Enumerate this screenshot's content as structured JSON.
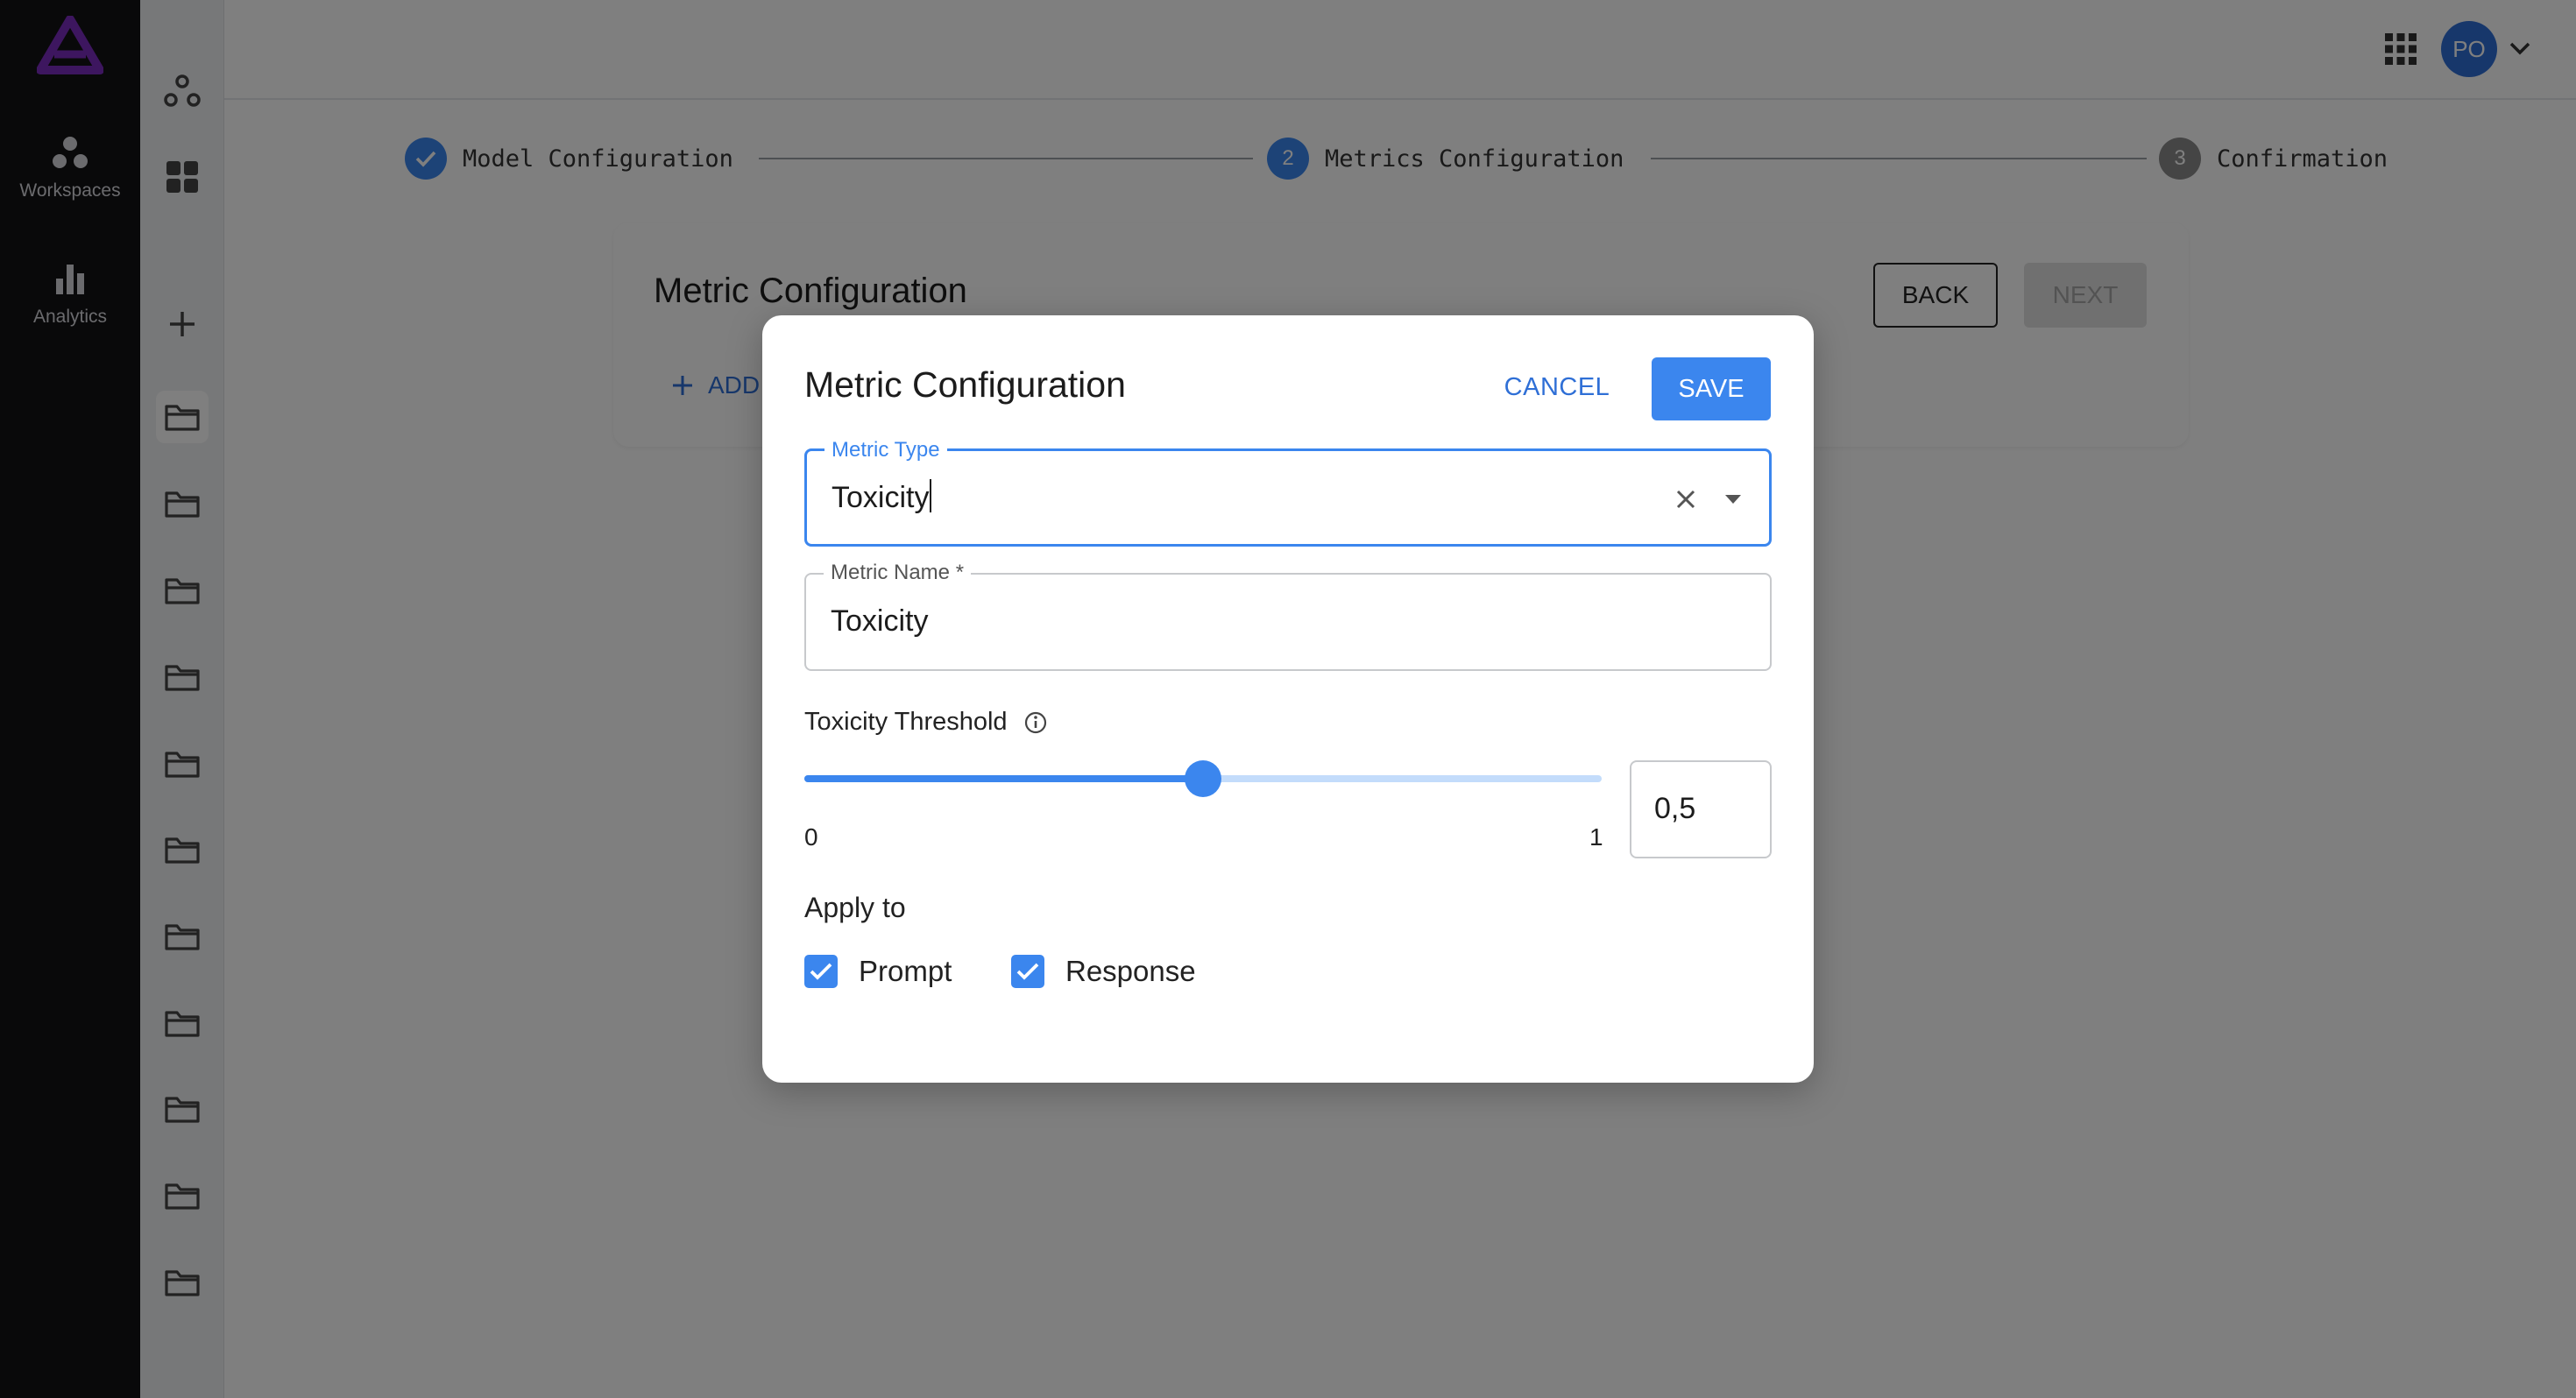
{
  "nav": {
    "items": [
      {
        "label": "Workspaces",
        "icon": "workspaces-icon"
      },
      {
        "label": "Analytics",
        "icon": "analytics-icon"
      }
    ],
    "logo_color": "#7b2cbf"
  },
  "sidebar": {
    "icons": [
      "network-icon",
      "grid-icon",
      "plus-icon",
      "folder-icon",
      "folder-icon",
      "folder-icon",
      "folder-icon",
      "folder-icon",
      "folder-icon",
      "folder-icon",
      "folder-icon",
      "folder-icon",
      "folder-icon",
      "folder-icon"
    ],
    "active_folder_index": 0
  },
  "header": {
    "avatar_initials": "PO",
    "apps_icon": "apps-grid-icon"
  },
  "stepper": {
    "steps": [
      {
        "number": "",
        "label": "Model Configuration",
        "state": "completed"
      },
      {
        "number": "2",
        "label": "Metrics Configuration",
        "state": "active"
      },
      {
        "number": "3",
        "label": "Confirmation",
        "state": "pending"
      }
    ]
  },
  "card": {
    "title": "Metric Configuration",
    "back_label": "BACK",
    "next_label": "NEXT",
    "add_label": "ADD"
  },
  "modal": {
    "title": "Metric Configuration",
    "cancel_label": "CANCEL",
    "save_label": "SAVE",
    "metric_type": {
      "label": "Metric Type",
      "value": "Toxicity"
    },
    "metric_name": {
      "label": "Metric Name *",
      "value": "Toxicity"
    },
    "threshold": {
      "label": "Toxicity Threshold",
      "min_label": "0",
      "max_label": "1",
      "value_text": "0,5",
      "value": 0.5
    },
    "apply_to": {
      "label": "Apply to",
      "options": [
        {
          "label": "Prompt",
          "checked": true
        },
        {
          "label": "Response",
          "checked": true
        }
      ]
    }
  },
  "colors": {
    "accent": "#3b86ee",
    "nav_bg": "#121214"
  }
}
